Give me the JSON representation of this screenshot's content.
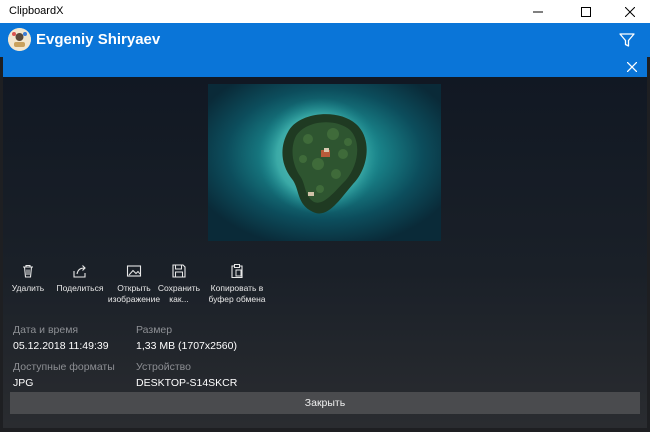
{
  "window": {
    "title": "ClipboardX"
  },
  "header": {
    "username": "Evgeniy Shiryaev"
  },
  "actions": [
    {
      "label": "Удалить"
    },
    {
      "label": "Поделиться"
    },
    {
      "label": "Открыть изображение"
    },
    {
      "label": "Сохранить как..."
    },
    {
      "label": "Копировать в буфер обмена"
    }
  ],
  "details": {
    "datetime_label": "Дата и время",
    "datetime_value": "05.12.2018 11:49:39",
    "size_label": "Размер",
    "size_value": "1,33 MB (1707x2560)",
    "formats_label": "Доступные форматы",
    "formats_value": "JPG",
    "device_label": "Устройство",
    "device_value": "DESKTOP-S14SKCR"
  },
  "close_label": "Закрыть",
  "colors": {
    "accent": "#0a75d8",
    "button": "#4a4b4e"
  }
}
